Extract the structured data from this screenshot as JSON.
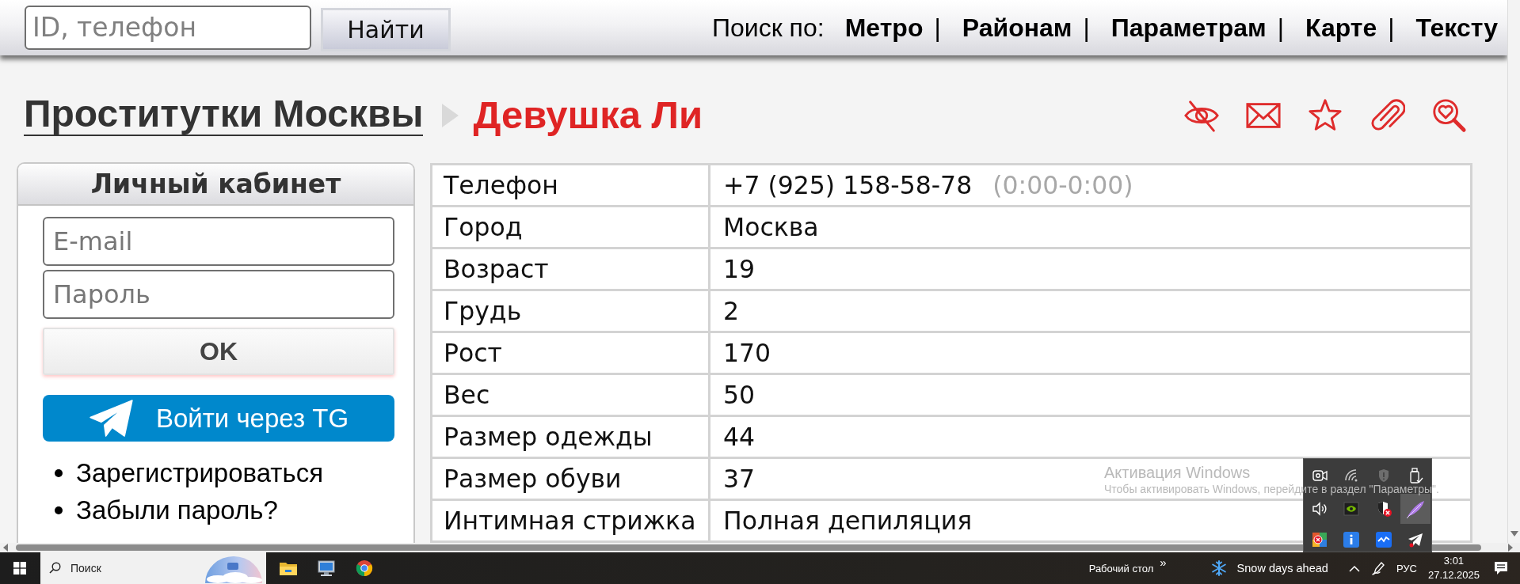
{
  "top_bar": {
    "search": {
      "placeholder": "ID, телефон"
    },
    "search_button": "Найти",
    "nav_label": "Поиск по:",
    "nav_links": [
      {
        "label": "Метро",
        "separator": "|"
      },
      {
        "label": "Районам",
        "separator": "|"
      },
      {
        "label": "Параметрам",
        "separator": "|"
      },
      {
        "label": "Карте",
        "separator": "|"
      },
      {
        "label": "Тексту"
      }
    ]
  },
  "breadcrumb": {
    "parent": "Проститутки Москвы",
    "current": "Девушка Ли"
  },
  "login_panel": {
    "title": "Личный кабинет",
    "email": {
      "placeholder": "E-mail"
    },
    "password": {
      "placeholder": "Пароль"
    },
    "submit_button": "OK",
    "telegram_button": "Войти через TG",
    "links": [
      "Зарегистрироваться",
      "Забыли пароль?"
    ]
  },
  "profile_table": {
    "rows": [
      {
        "label": "Телефон",
        "value": "+7 (925) 158-58-78",
        "note": "(0:00-0:00)"
      },
      {
        "label": "Город",
        "value": "Москва"
      },
      {
        "label": "Возраст",
        "value": "19"
      },
      {
        "label": "Грудь",
        "value": "2"
      },
      {
        "label": "Рост",
        "value": "170"
      },
      {
        "label": "Вес",
        "value": "50"
      },
      {
        "label": "Размер одежды",
        "value": "44"
      },
      {
        "label": "Размер обуви",
        "value": "37"
      },
      {
        "label": "Интимная стрижка",
        "value": "Полная депиляция"
      }
    ]
  },
  "activation_notice": {
    "title": "Активация Windows",
    "message": "Чтобы активировать Windows, перейдите в раздел \"Параметры\"."
  },
  "taskbar": {
    "search": {
      "placeholder": "Поиск"
    },
    "toolbar_label": "Рабочий стол",
    "toolbar_overflow": "»",
    "weather": "Snow days ahead",
    "language": "РУС",
    "time": "3:01",
    "date": "27.12.2025"
  }
}
